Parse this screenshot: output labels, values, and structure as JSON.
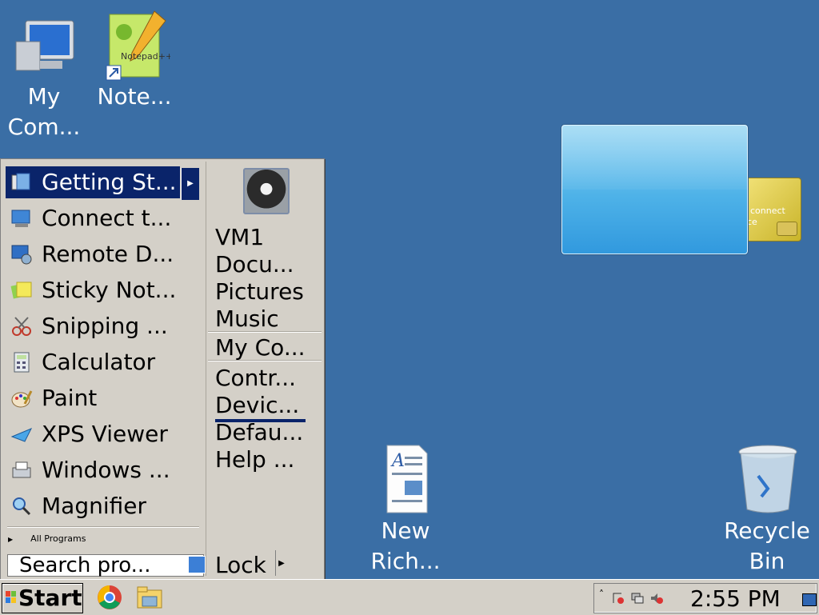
{
  "desktop": {
    "icons": [
      {
        "label": "My\nCom...",
        "icon": "computer-icon"
      },
      {
        "label": "Note...",
        "icon": "notepad-plus-plus-icon"
      },
      {
        "label": "New\nRich...",
        "icon": "rich-text-document-icon"
      },
      {
        "label": "Recycle\nBin",
        "icon": "recycle-bin-icon"
      }
    ],
    "gadget": {
      "card_text": "connect",
      "card_text2": "ce"
    }
  },
  "start_menu": {
    "programs": [
      {
        "label": "Getting St...",
        "icon": "getting-started-icon",
        "selected": true
      },
      {
        "label": "Connect t...",
        "icon": "projector-icon"
      },
      {
        "label": "Remote D...",
        "icon": "remote-desktop-icon"
      },
      {
        "label": "Sticky Not...",
        "icon": "sticky-notes-icon"
      },
      {
        "label": "Snipping ...",
        "icon": "scissors-icon"
      },
      {
        "label": "Calculator",
        "icon": "calculator-icon"
      },
      {
        "label": "Paint",
        "icon": "paint-palette-icon"
      },
      {
        "label": "XPS Viewer",
        "icon": "xps-viewer-icon"
      },
      {
        "label": "Windows ...",
        "icon": "fax-scan-icon"
      },
      {
        "label": "Magnifier",
        "icon": "magnifier-icon"
      }
    ],
    "all_programs": "All Programs",
    "search_placeholder": "Search pro...",
    "places": [
      {
        "label": "VM1"
      },
      {
        "label": "Docu..."
      },
      {
        "label": "Pictures"
      },
      {
        "label": "Music"
      },
      {
        "label": "My Co..."
      },
      {
        "label": "Contr..."
      },
      {
        "label": "Devic...",
        "focused": true
      },
      {
        "label": "Defau..."
      },
      {
        "label": "Help ..."
      }
    ],
    "lock_label": "Lock"
  },
  "taskbar": {
    "start_label": "Start",
    "pinned": [
      "chrome-icon",
      "file-explorer-icon"
    ],
    "tray_icons": [
      "action-center-icon",
      "network-icon",
      "volume-muted-icon"
    ],
    "clock": "2:55 PM"
  },
  "colors": {
    "desktop_bg": "#3a6ea5",
    "menu_bg": "#d4d0c8",
    "selection": "#0a246a"
  }
}
